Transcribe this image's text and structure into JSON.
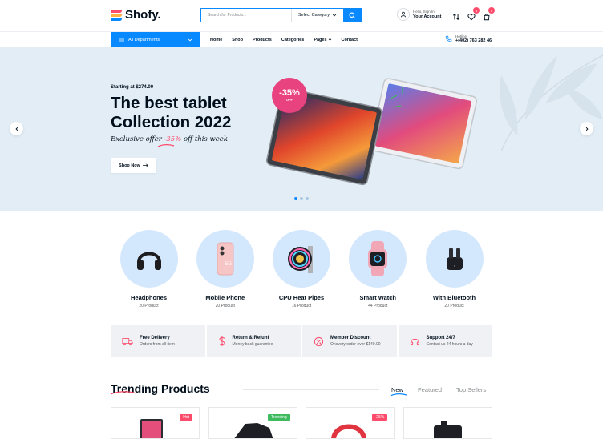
{
  "header": {
    "logo": "Shofy.",
    "search_placeholder": "Search for Products...",
    "search_category": "Select Category",
    "account_greeting": "Hello, Sign In",
    "account_label": "Your Account",
    "compare_badge": "4",
    "wishlist_badge": "0",
    "cart_badge": "0"
  },
  "nav": {
    "all_departments": "All Departments",
    "items": [
      "Home",
      "Shop",
      "Products",
      "Categories",
      "Pages",
      "Contact"
    ],
    "hotline_label": "Hotline:",
    "hotline_number": "+(402) 763 282 46"
  },
  "hero": {
    "pre": "Starting at $274.00",
    "title": "The best tablet Collection 2022",
    "sub_prefix": "Exclusive offer ",
    "sub_discount": "-35%",
    "sub_suffix": " off this week",
    "button": "Shop Now",
    "discount_badge": "-35%",
    "discount_off": "OFF",
    "slides": 3,
    "active_slide": 1
  },
  "categories": [
    {
      "name": "Headphones",
      "count": "20 Product",
      "icon": "headphones-icon"
    },
    {
      "name": "Mobile Phone",
      "count": "20 Product",
      "icon": "mobile-phone-icon"
    },
    {
      "name": "CPU Heat Pipes",
      "count": "16 Product",
      "icon": "cpu-fan-icon"
    },
    {
      "name": "Smart Watch",
      "count": "44 Product",
      "icon": "smart-watch-icon"
    },
    {
      "name": "With Bluetooth",
      "count": "20 Product",
      "icon": "earbuds-icon"
    }
  ],
  "features": [
    {
      "title": "Free Delivery",
      "desc": "Orders from all item",
      "icon": "truck-icon"
    },
    {
      "title": "Return & Refunf",
      "desc": "Money back guarantee",
      "icon": "dollar-icon"
    },
    {
      "title": "Member Discount",
      "desc": "Onevery order over $140.00",
      "icon": "discount-icon"
    },
    {
      "title": "Support 24/7",
      "desc": "Contact us 24 hours a day",
      "icon": "headset-icon"
    }
  ],
  "trending": {
    "title": "Trending Products",
    "tabs": [
      "New",
      "Featured",
      "Top Sellers"
    ],
    "active_tab": 0,
    "badges": [
      {
        "label": "Hot",
        "color": "#fd4b6b"
      },
      {
        "label": "Trending",
        "color": "#3ebb5f"
      },
      {
        "label": "-25%",
        "color": "#fd4b6b"
      },
      {
        "label": "",
        "color": ""
      }
    ]
  },
  "colors": {
    "accent": "#0989ff",
    "pink": "#fd4b6b",
    "hero_bg": "#e2edf6"
  }
}
